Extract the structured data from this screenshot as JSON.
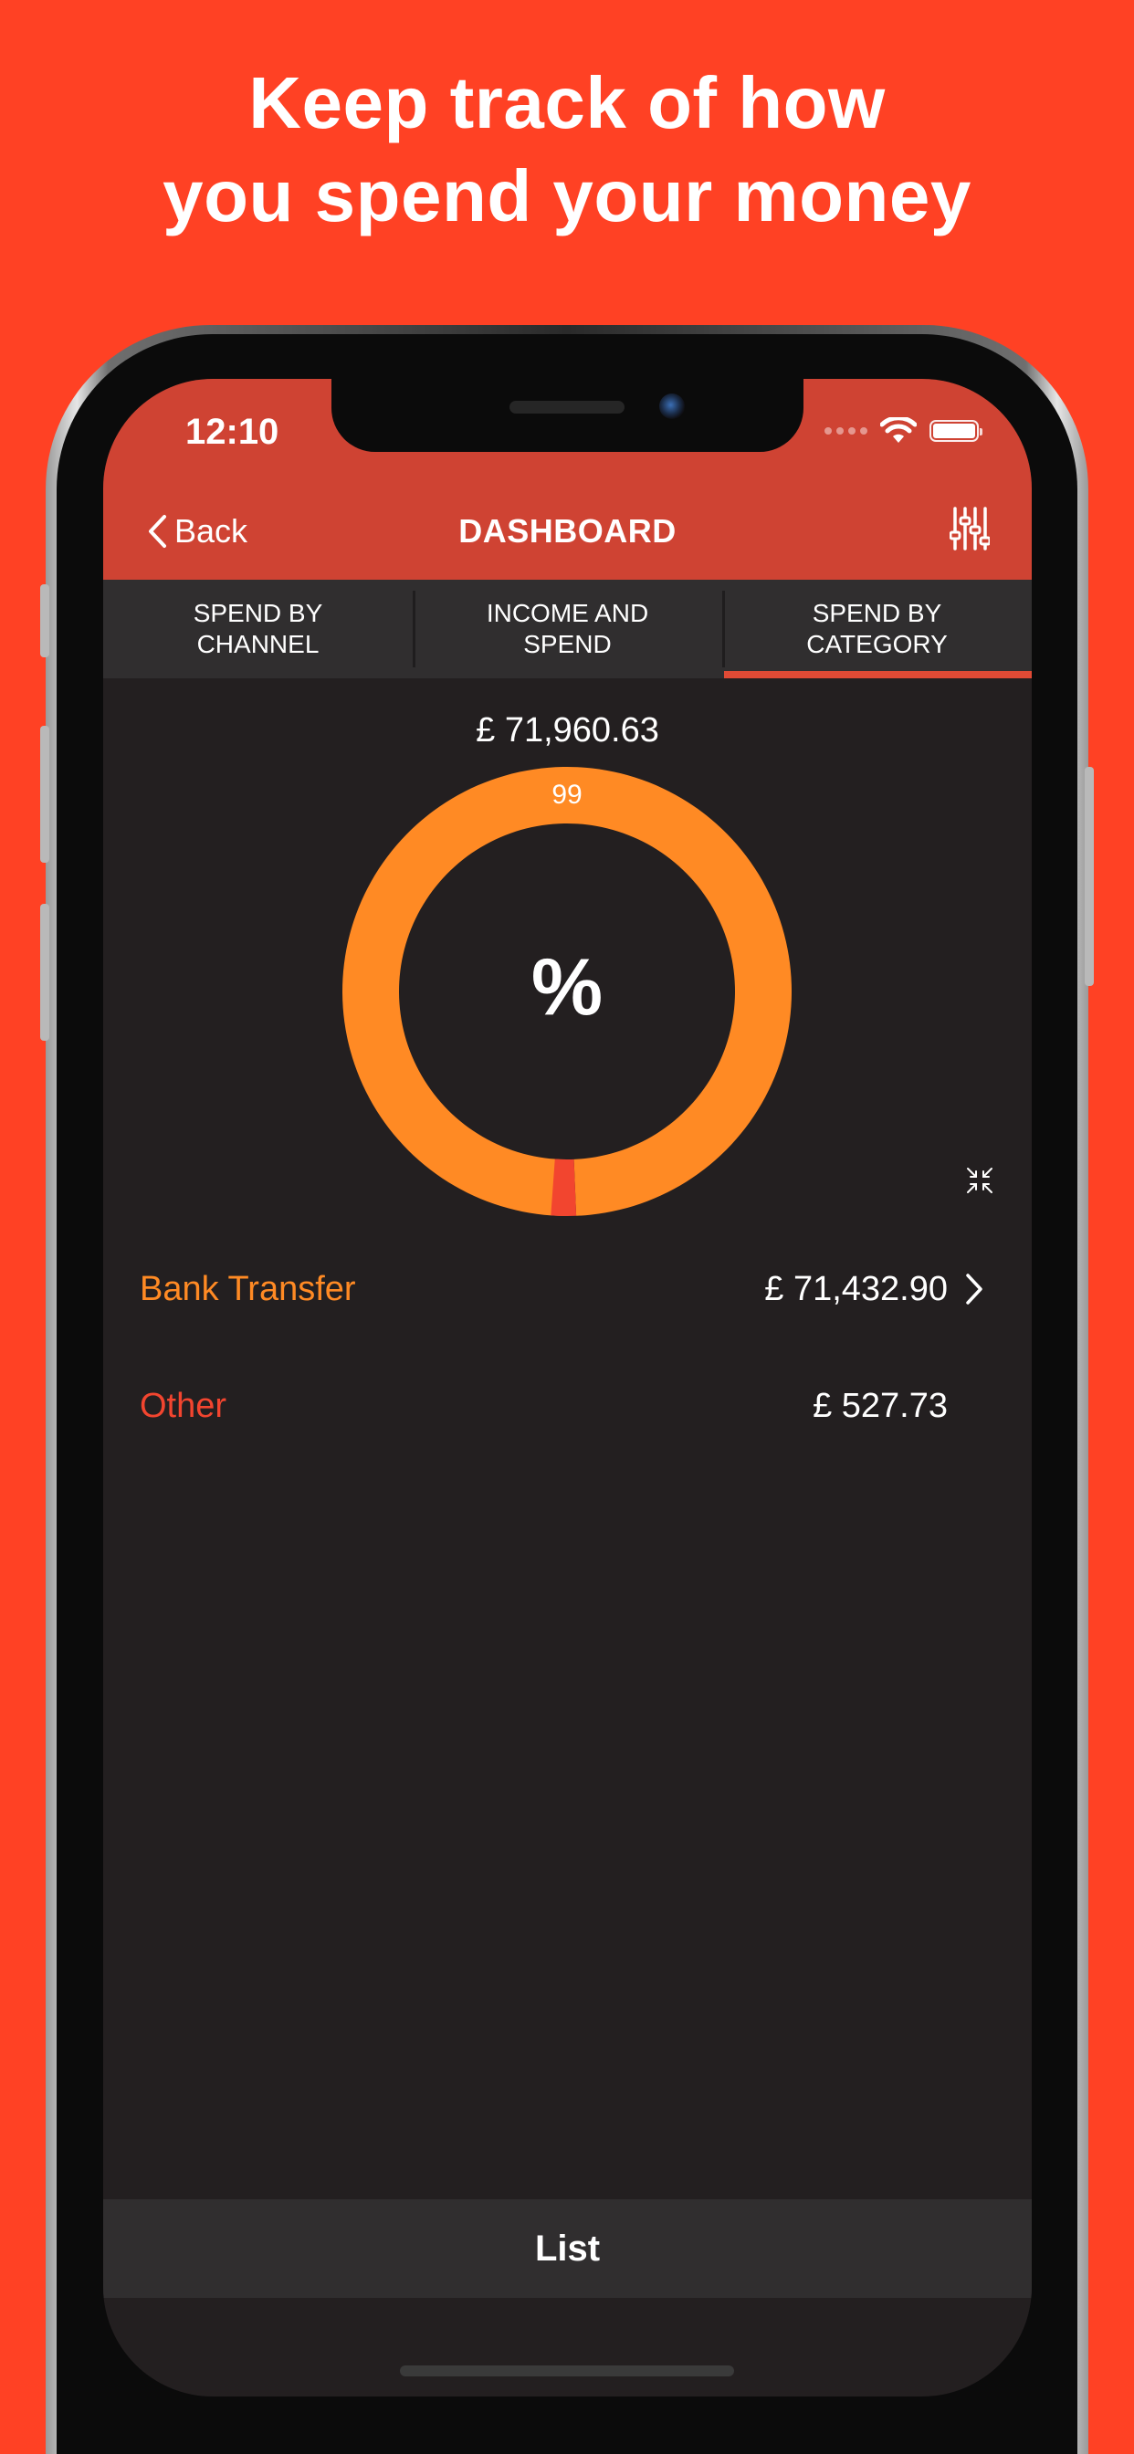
{
  "headline": {
    "line1": "Keep track of how",
    "line2": "you spend your money"
  },
  "status_bar": {
    "time": "12:10",
    "icons": [
      "signal-dots-icon",
      "wifi-icon",
      "battery-icon"
    ]
  },
  "nav": {
    "back_label": "Back",
    "title": "DASHBOARD",
    "filter_icon": "sliders-icon"
  },
  "tabs": [
    {
      "line1": "SPEND BY",
      "line2": "CHANNEL",
      "active": false
    },
    {
      "line1": "INCOME AND",
      "line2": "SPEND",
      "active": false
    },
    {
      "line1": "SPEND BY",
      "line2": "CATEGORY",
      "active": true
    }
  ],
  "summary": {
    "total": "£ 71,960.63",
    "center_symbol": "%"
  },
  "chart_data": {
    "type": "pie",
    "title": "",
    "categories": [
      "Bank Transfer",
      "Other"
    ],
    "values": [
      71432.9,
      527.73
    ],
    "data_labels": [
      "99",
      ""
    ],
    "colors": [
      "#FF8A24",
      "#F2452F"
    ]
  },
  "categories": [
    {
      "label": "Bank Transfer",
      "amount": "£ 71,432.90",
      "has_chevron": true
    },
    {
      "label": "Other",
      "amount": "£ 527.73",
      "has_chevron": false
    }
  ],
  "bottom": {
    "list_label": "List"
  },
  "colors": {
    "background": "#FF4124",
    "nav_bar": "#CF4333",
    "screen": "#231F20",
    "tab_bar": "#302E2F",
    "accent_orange": "#FF8A24",
    "accent_red": "#F2452F"
  }
}
